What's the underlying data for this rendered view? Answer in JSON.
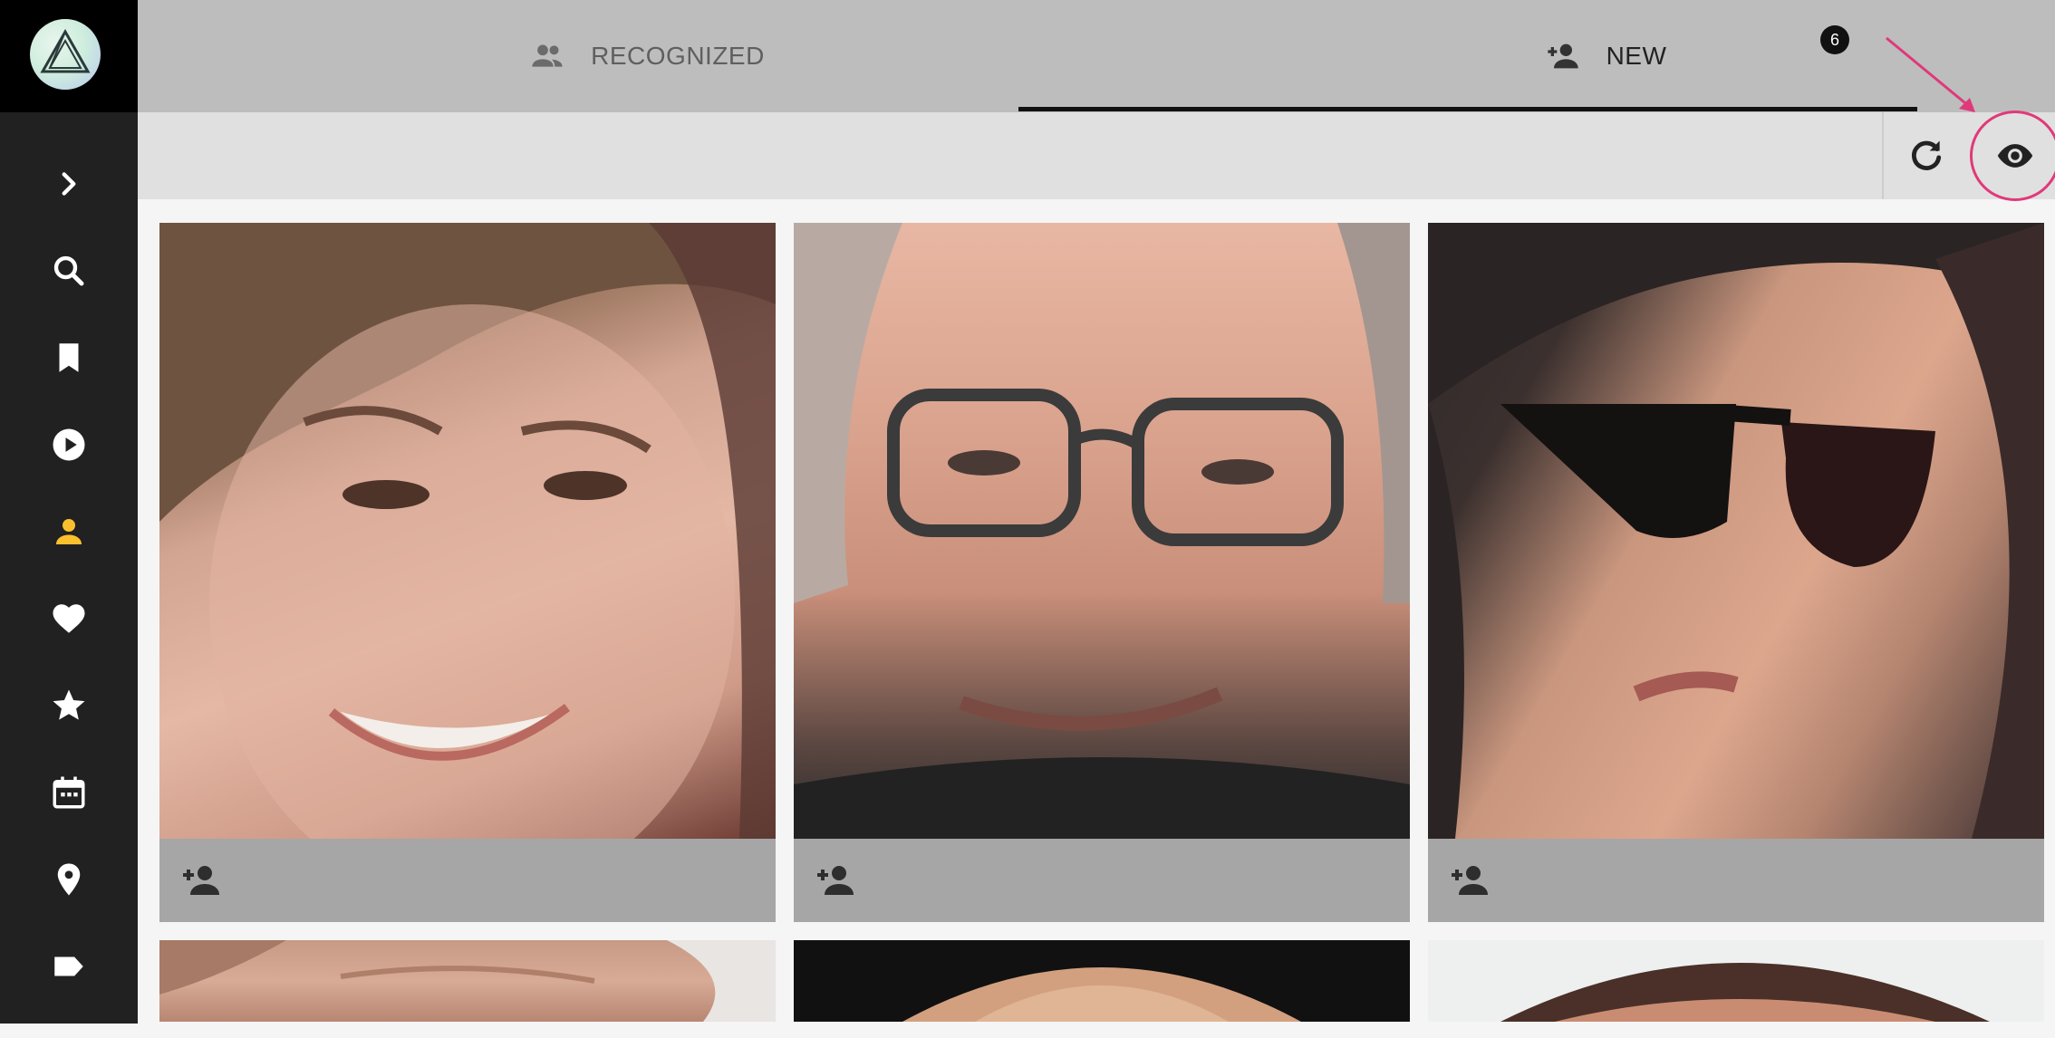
{
  "sidebar": {
    "items": [
      {
        "name": "expand",
        "icon": "chevron-right-icon"
      },
      {
        "name": "search",
        "icon": "search-icon"
      },
      {
        "name": "bookmarks",
        "icon": "bookmark-icon"
      },
      {
        "name": "videos",
        "icon": "play-circle-icon"
      },
      {
        "name": "people",
        "icon": "person-icon",
        "active": true
      },
      {
        "name": "favorites",
        "icon": "heart-icon"
      },
      {
        "name": "starred",
        "icon": "star-icon"
      },
      {
        "name": "calendar",
        "icon": "calendar-icon"
      },
      {
        "name": "places",
        "icon": "map-pin-icon"
      },
      {
        "name": "labels",
        "icon": "label-icon"
      }
    ],
    "active_color": "#fbc02d"
  },
  "tabs": {
    "recognized": {
      "label": "RECOGNIZED",
      "icon": "people-group-icon"
    },
    "new": {
      "label": "NEW",
      "icon": "person-add-icon",
      "badge": "6",
      "selected": true
    }
  },
  "toolbar": {
    "refresh": {
      "icon": "refresh-icon"
    },
    "show_hidden": {
      "icon": "eye-icon",
      "highlighted": true
    },
    "highlight_color": "#e0397a"
  },
  "faces": [
    {
      "id": "face-1",
      "action_icon": "person-add-icon"
    },
    {
      "id": "face-2",
      "action_icon": "person-add-icon"
    },
    {
      "id": "face-3",
      "action_icon": "person-add-icon"
    },
    {
      "id": "face-4"
    },
    {
      "id": "face-5"
    },
    {
      "id": "face-6"
    }
  ]
}
